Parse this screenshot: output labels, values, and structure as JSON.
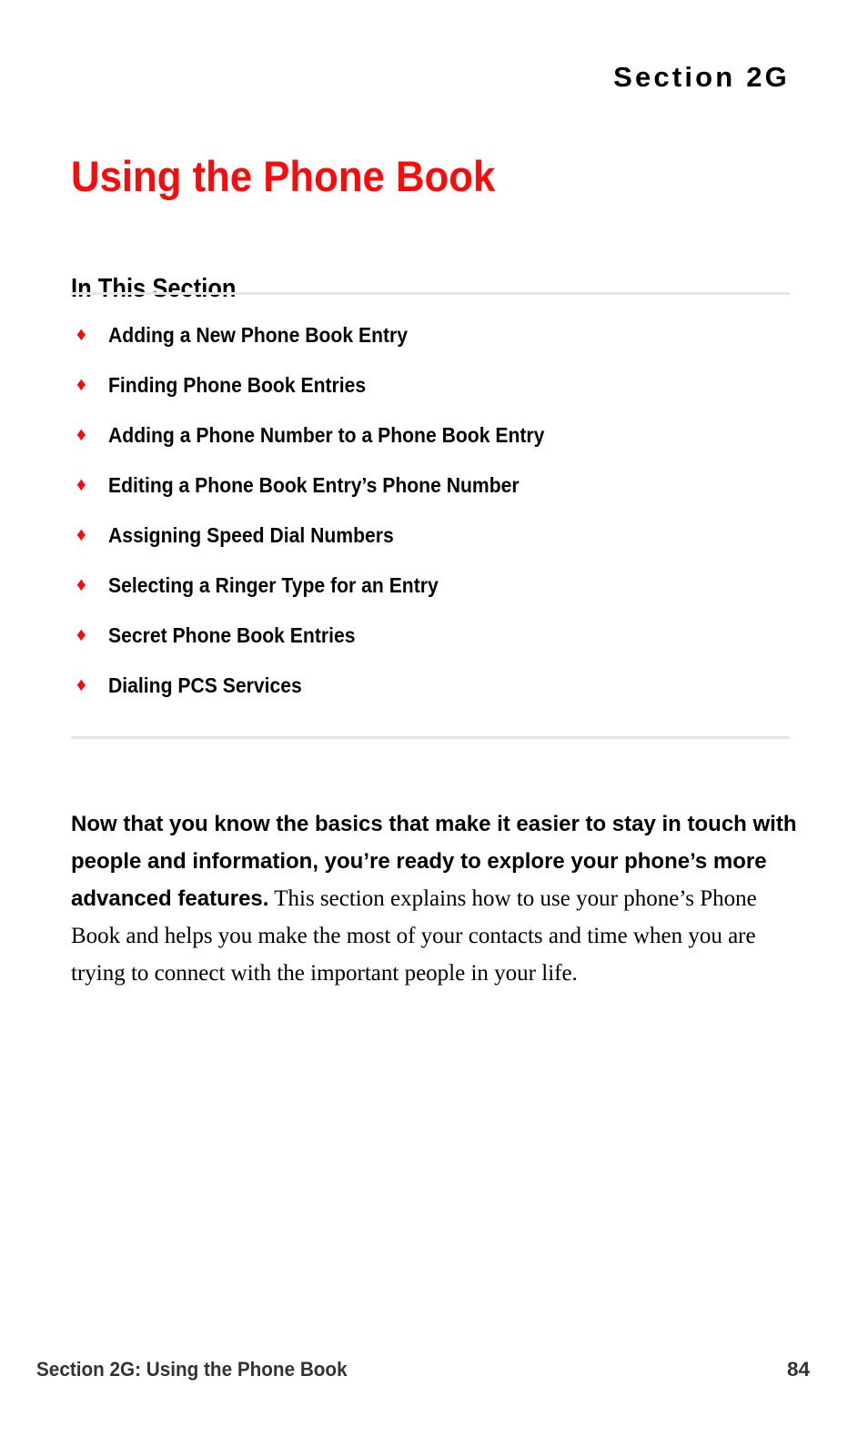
{
  "page": {
    "section_header": "Section 2G",
    "chapter_title": "Using the Phone Book",
    "background_color": "#ffffff",
    "accent_color": "#fb0a0a",
    "rule_color": "#e6e6e6"
  },
  "in_this_section": {
    "heading": "In This Section",
    "bullet_glyph": "♦",
    "items": [
      {
        "label": "Adding a New Phone Book Entry"
      },
      {
        "label": "Finding Phone Book Entries"
      },
      {
        "label": "Adding a Phone Number to a Phone Book Entry"
      },
      {
        "label": "Editing a Phone Book Entry’s Phone Number"
      },
      {
        "label": "Assigning Speed Dial Numbers"
      },
      {
        "label": "Selecting a Ringer Type for an Entry"
      },
      {
        "label": "Secret Phone Book Entries"
      },
      {
        "label": "Dialing PCS Services"
      }
    ]
  },
  "intro": {
    "lead_in": "Now that you know the basics that make it easier to stay in touch with people and information, you’re ready to explore your phone’s more advanced features.",
    "rest": " This section explains how to use your phone’s Phone Book and helps you make the most of your contacts and time when you are trying to connect with the important people in your life."
  },
  "footer": {
    "left_text": "Section 2G: Using the Phone Book",
    "page_number": "84"
  }
}
